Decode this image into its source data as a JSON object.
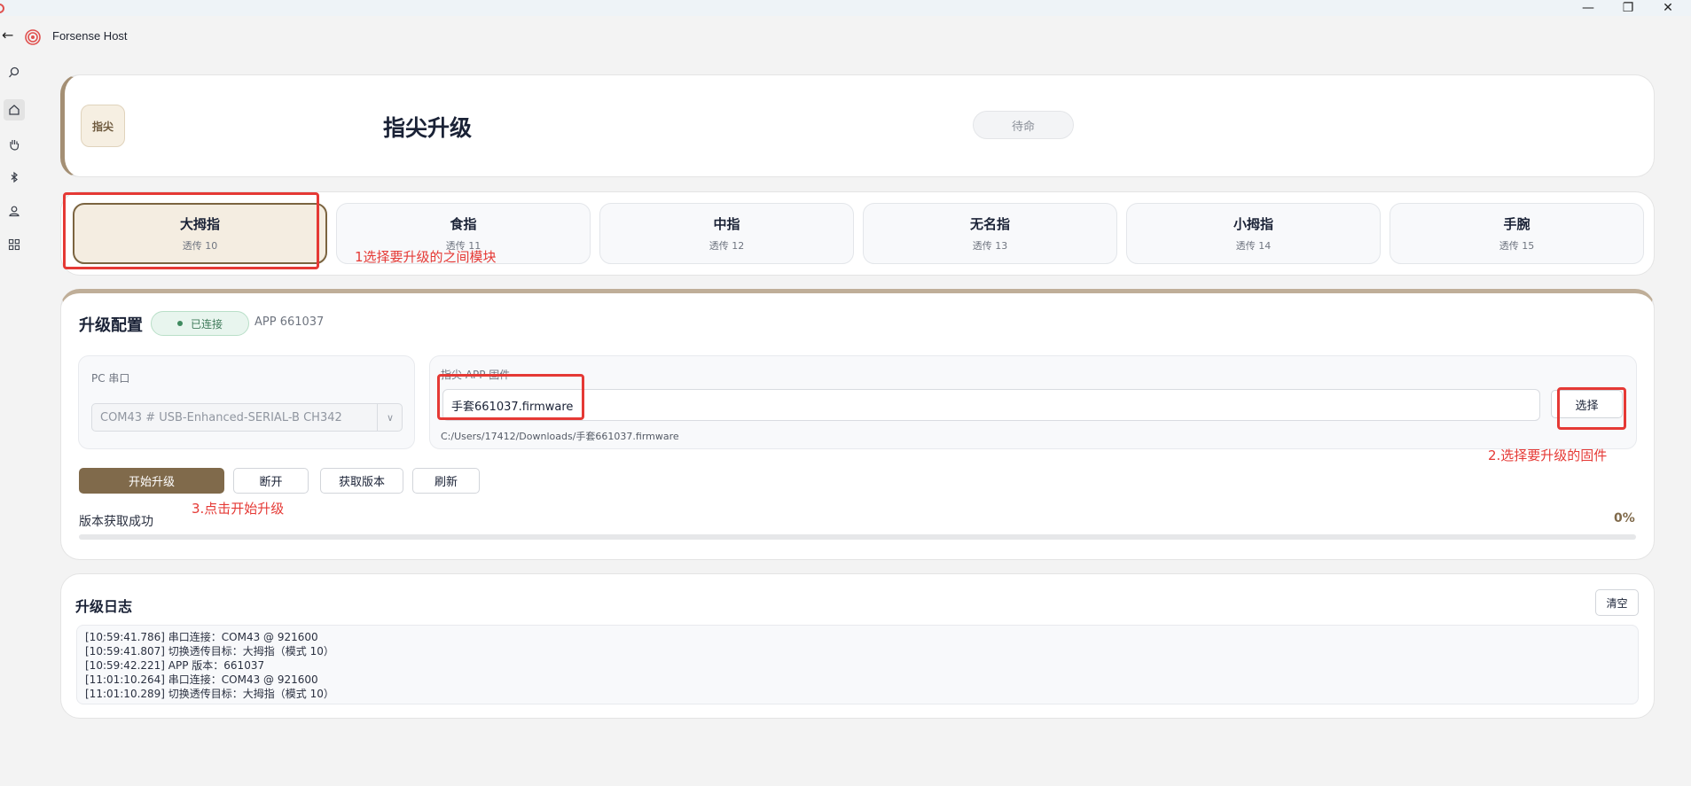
{
  "window": {
    "app_name": "Forsense Host",
    "minimize": "—",
    "restore": "❐",
    "close": "✕"
  },
  "sidebar": {
    "items": [
      {
        "name": "search-icon",
        "glyph": "⌕"
      },
      {
        "name": "home-icon",
        "glyph": "⌂"
      },
      {
        "name": "hand-icon",
        "glyph": "✋"
      },
      {
        "name": "bluetooth-icon",
        "glyph": "ᛒ"
      },
      {
        "name": "user-icon",
        "glyph": "⚇"
      },
      {
        "name": "grid-icon",
        "glyph": "⊞"
      }
    ]
  },
  "hero": {
    "badge": "指尖",
    "title": "指尖升级",
    "status": "待命"
  },
  "tabs": [
    {
      "name": "大拇指",
      "sub": "透传 10"
    },
    {
      "name": "食指",
      "sub": "透传 11"
    },
    {
      "name": "中指",
      "sub": "透传 12"
    },
    {
      "name": "无名指",
      "sub": "透传 13"
    },
    {
      "name": "小拇指",
      "sub": "透传 14"
    },
    {
      "name": "手腕",
      "sub": "透传 15"
    }
  ],
  "config": {
    "title": "升级配置",
    "connection": "已连接",
    "app_version": "APP 661037",
    "port_label": "PC 串口",
    "port_value": "COM43 # USB-Enhanced-SERIAL-B CH342",
    "fw_label": "指尖 APP 固件",
    "fw_file": "手套661037.firmware",
    "fw_path": "C:/Users/17412/Downloads/手套661037.firmware",
    "select_button": "选择",
    "buttons": {
      "start": "开始升级",
      "disconnect": "断开",
      "get_version": "获取版本",
      "refresh": "刷新"
    },
    "status": "版本获取成功",
    "progress": 0,
    "progress_label": "0%"
  },
  "log": {
    "title": "升级日志",
    "clear": "清空",
    "lines": [
      "[10:59:41.786] 串口连接：COM43 @ 921600",
      "[10:59:41.807] 切换透传目标：大拇指（模式 10）",
      "[10:59:42.221] APP 版本：661037",
      "[11:01:10.264] 串口连接：COM43 @ 921600",
      "[11:01:10.289] 切换透传目标：大拇指（模式 10）"
    ]
  },
  "annotations": {
    "step1": "1选择要升级的之间模块",
    "step2": "2.选择要升级的固件",
    "step3": "3.点击开始升级"
  }
}
